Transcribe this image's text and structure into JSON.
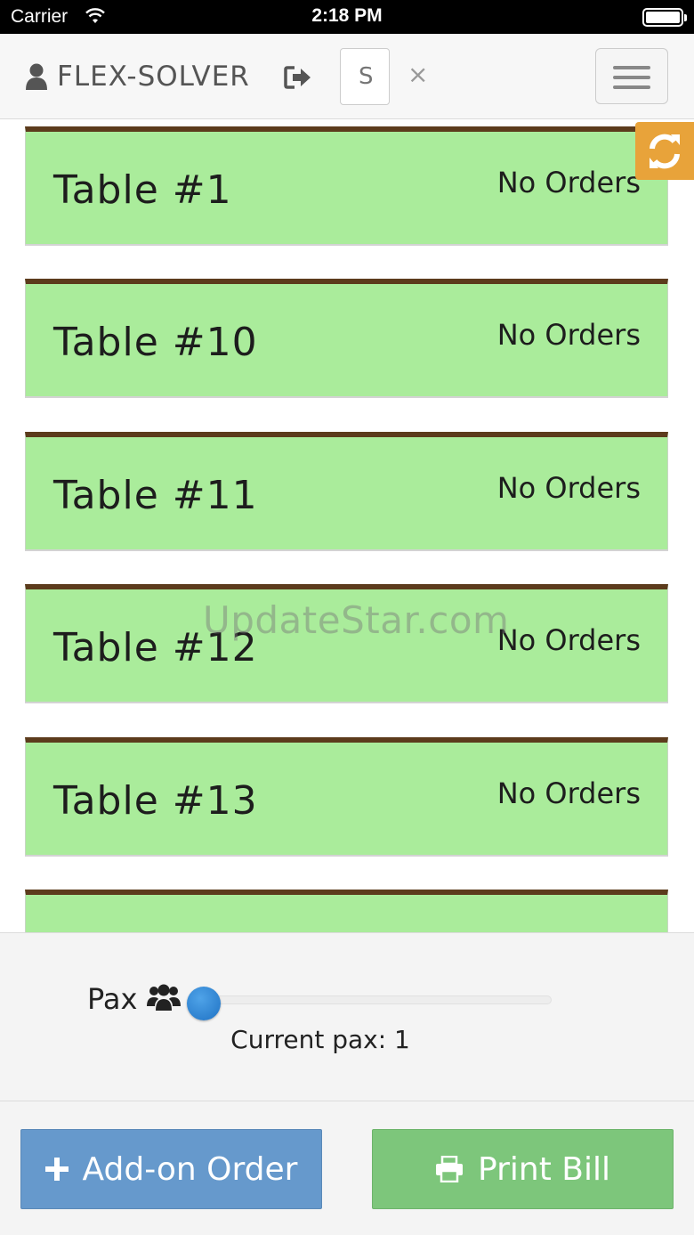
{
  "status_bar": {
    "carrier": "Carrier",
    "time": "2:18 PM"
  },
  "navbar": {
    "brand": "FLEX-SOLVER",
    "search_placeholder": "S",
    "clear_symbol": "×"
  },
  "tables": [
    {
      "name": "Table #1",
      "status": "No Orders"
    },
    {
      "name": "Table #10",
      "status": "No Orders"
    },
    {
      "name": "Table #11",
      "status": "No Orders"
    },
    {
      "name": "Table #12",
      "status": "No Orders"
    },
    {
      "name": "Table #13",
      "status": "No Orders"
    },
    {
      "name": "",
      "status": ""
    }
  ],
  "watermark": "UpdateStar.com",
  "pax": {
    "label": "Pax",
    "current_text": "Current pax: 1",
    "value": 1
  },
  "footer": {
    "addon_label": "Add-on Order",
    "print_label": "Print Bill"
  },
  "colors": {
    "card_bg": "#aaec9b",
    "card_border": "#5c3b1c",
    "refresh": "#e8a33a",
    "addon": "#6699cc",
    "print": "#7dc67b"
  },
  "icons": {
    "brand": "user-icon",
    "logout": "sign-out-icon",
    "refresh": "refresh-icon",
    "pax": "users-icon",
    "addon": "plus-icon",
    "print": "printer-icon"
  }
}
